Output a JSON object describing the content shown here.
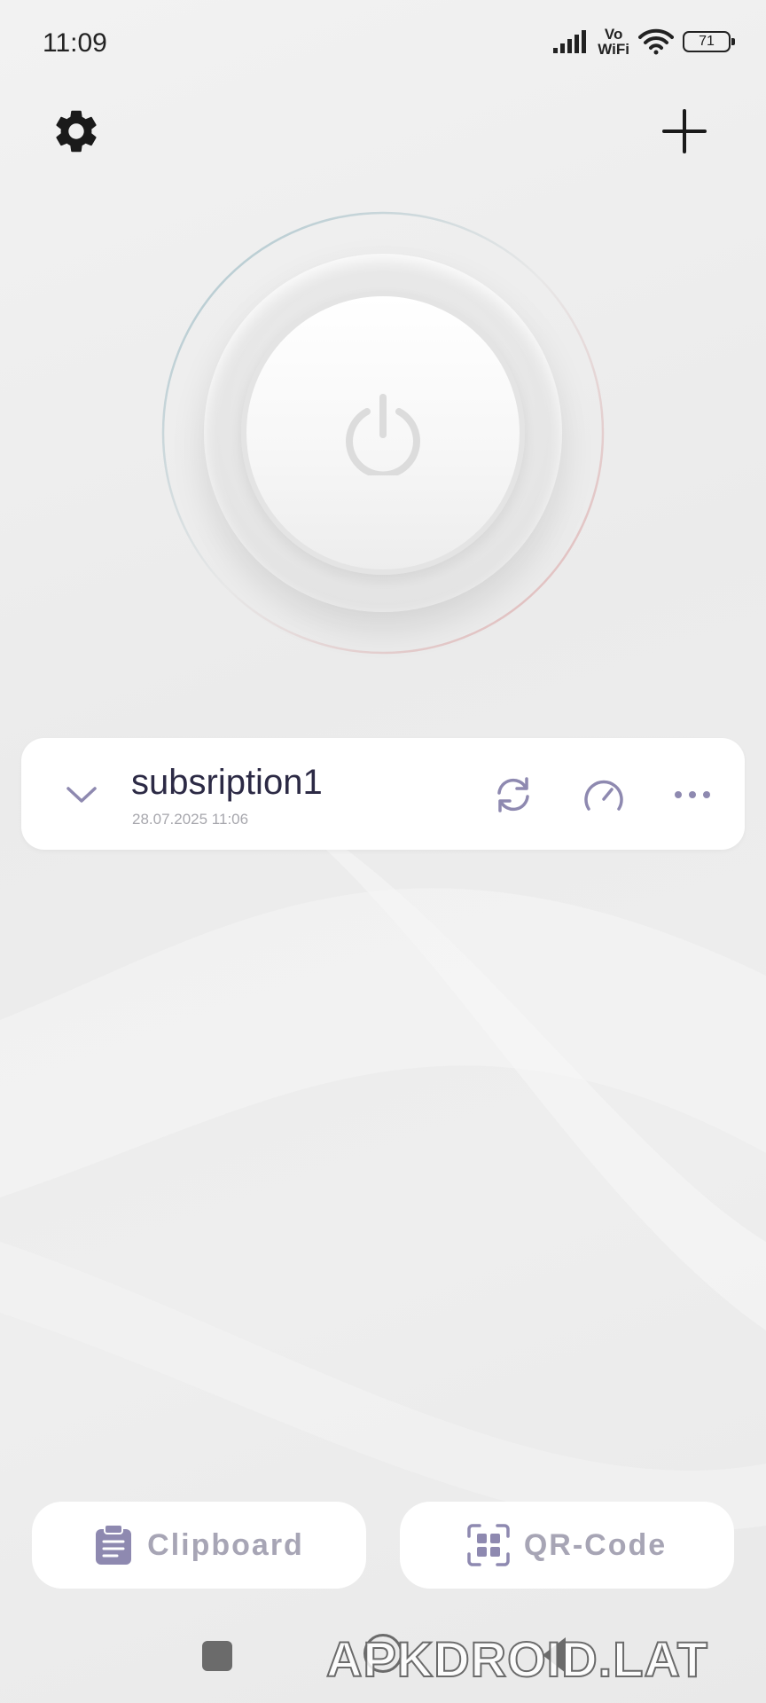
{
  "status_bar": {
    "time": "11:09",
    "vowifi_top": "Vo",
    "vowifi_bottom": "WiFi",
    "battery": "71",
    "icons": [
      "signal-icon",
      "wifi-icon",
      "battery-icon"
    ]
  },
  "header": {
    "icons": [
      "gear-icon",
      "plus-icon"
    ]
  },
  "power_button": {
    "icon": "power-icon",
    "ring_colors": [
      "#a9c4cc",
      "#e0b4b4"
    ]
  },
  "subscription": {
    "name": "subsription1",
    "updated": "28.07.2025 11:06",
    "icons": [
      "chevron-down-icon",
      "refresh-icon",
      "speedometer-icon",
      "more-icon"
    ]
  },
  "bottom": {
    "clipboard_label": "Clipboard",
    "qr_label": "QR-Code",
    "accent": "#8e89b0"
  },
  "watermark": "APKDROID.LAT"
}
